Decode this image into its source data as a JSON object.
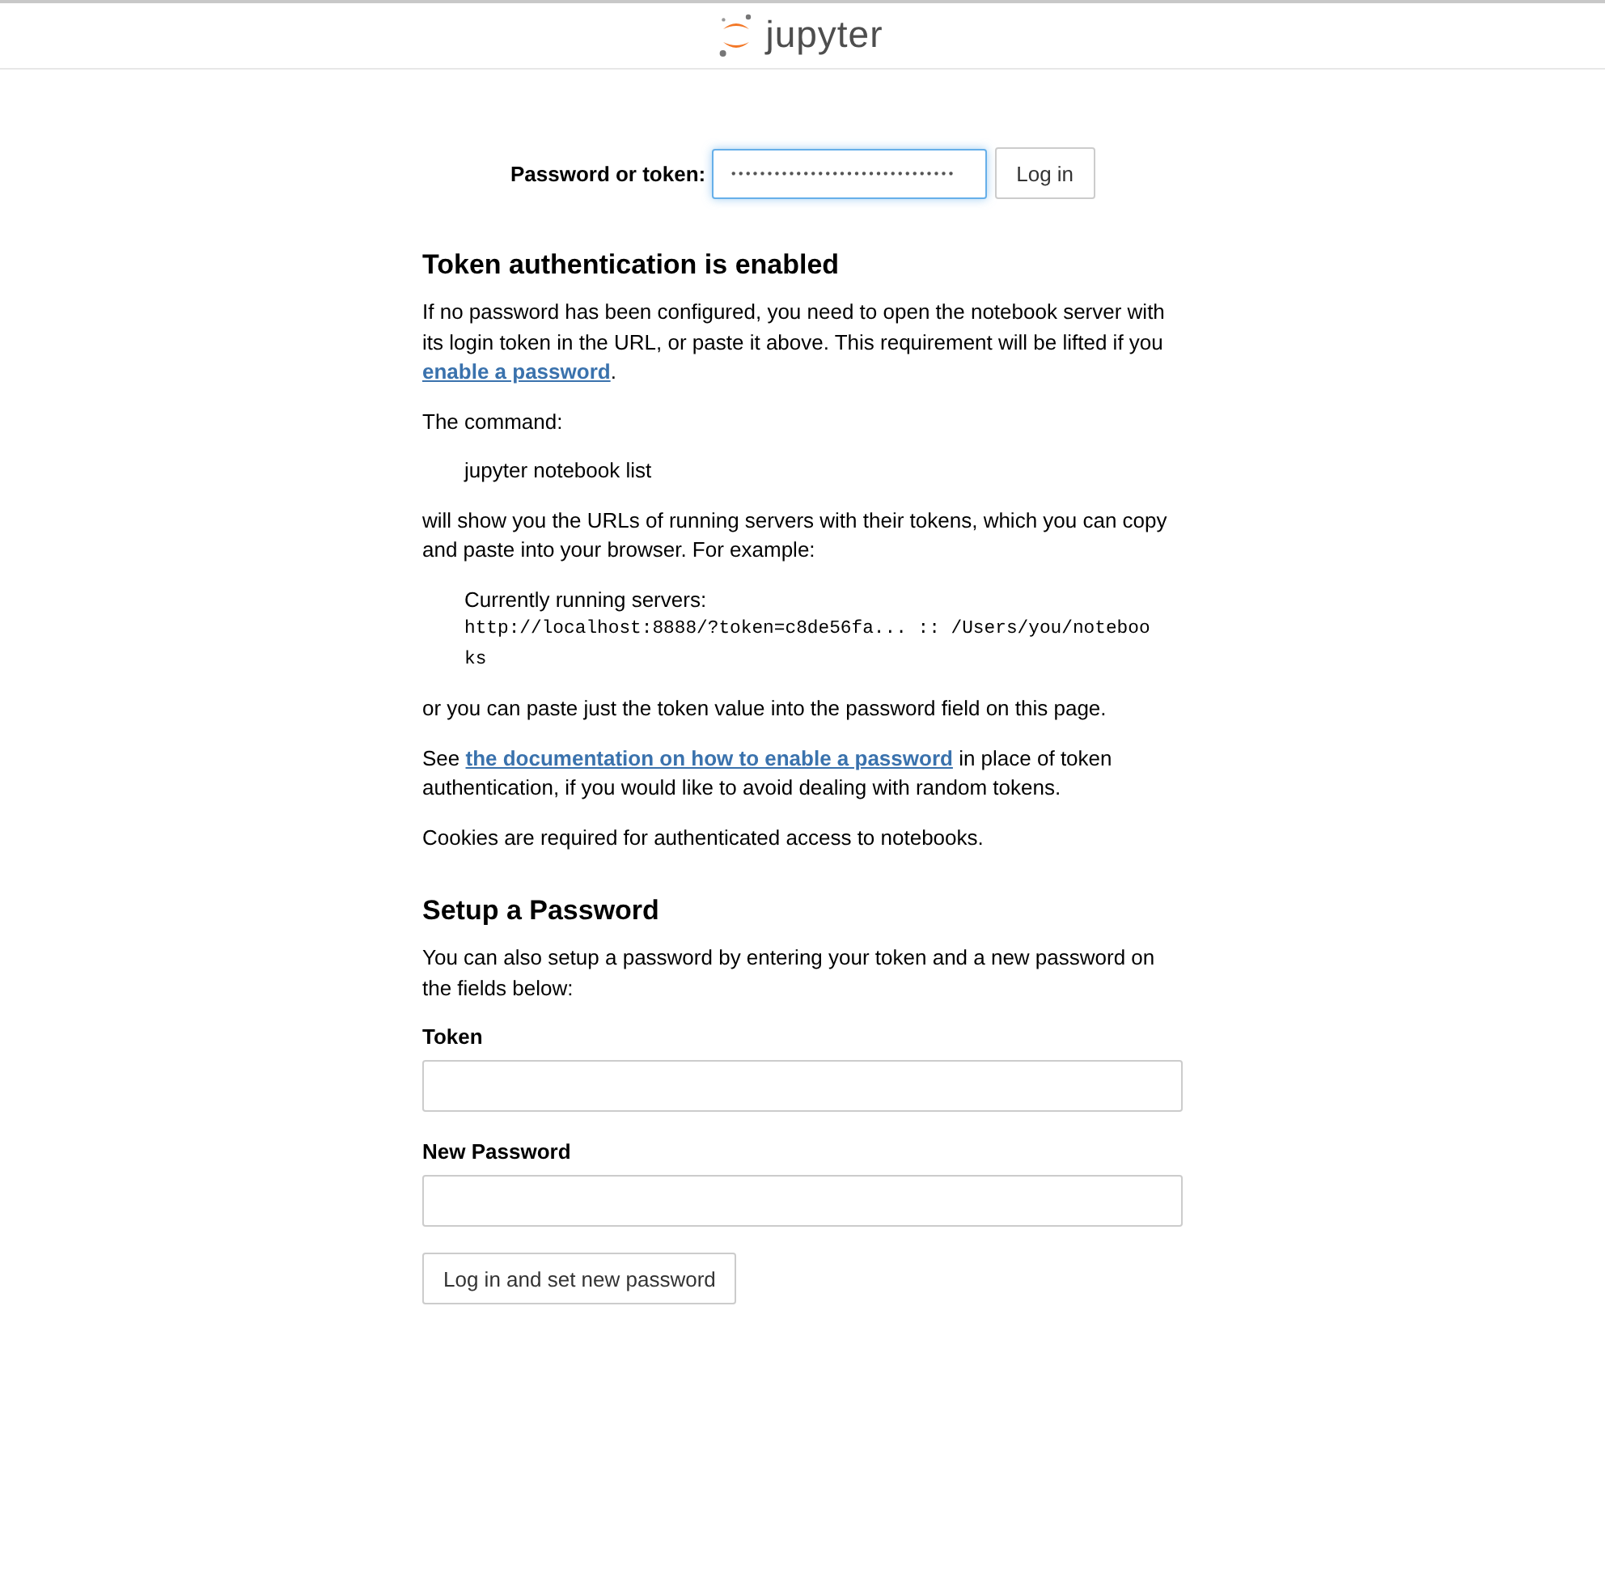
{
  "header": {
    "logo_text": "jupyter"
  },
  "login": {
    "label": "Password or token:",
    "password_field": {
      "value": "•••••••••••••••••••••••••••••••",
      "focused": true
    },
    "button": "Log in"
  },
  "token_section": {
    "title": "Token authentication is enabled",
    "blocks": [
      {
        "kind": "paragraph",
        "parts": [
          {
            "kind": "text",
            "text": "If no password has been configured, you need to open the notebook server with its login token in the URL, or paste it above. This requirement will be lifted if you "
          },
          {
            "kind": "link",
            "text": "enable a password"
          },
          {
            "kind": "text",
            "text": "."
          }
        ]
      },
      {
        "kind": "paragraph",
        "parts": [
          {
            "kind": "text",
            "text": "The command:"
          }
        ]
      },
      {
        "kind": "code",
        "lines": [
          {
            "kind": "plain",
            "text": "jupyter notebook list"
          }
        ]
      },
      {
        "kind": "paragraph",
        "parts": [
          {
            "kind": "text",
            "text": "will show you the URLs of running servers with their tokens, which you can copy and paste into your browser. For example:"
          }
        ]
      },
      {
        "kind": "code",
        "lines": [
          {
            "kind": "plain",
            "text": "Currently running servers:"
          },
          {
            "kind": "mono",
            "text": "http://localhost:8888/?token=c8de56fa... :: /Users/you/notebooks"
          }
        ]
      },
      {
        "kind": "paragraph",
        "parts": [
          {
            "kind": "text",
            "text": "or you can paste just the token value into the password field on this page."
          }
        ]
      },
      {
        "kind": "paragraph",
        "parts": [
          {
            "kind": "text",
            "text": "See "
          },
          {
            "kind": "link",
            "text": "the documentation on how to enable a password"
          },
          {
            "kind": "text",
            "text": " in place of token authentication, if you would like to avoid dealing with random tokens."
          }
        ]
      },
      {
        "kind": "paragraph",
        "parts": [
          {
            "kind": "text",
            "text": "Cookies are required for authenticated access to notebooks."
          }
        ]
      }
    ]
  },
  "setup_section": {
    "title": "Setup a Password",
    "intro": "You can also setup a password by entering your token and a new password on the fields below:",
    "fields": [
      {
        "label": "Token"
      },
      {
        "label": "New Password"
      }
    ],
    "button": "Log in and set new password"
  }
}
